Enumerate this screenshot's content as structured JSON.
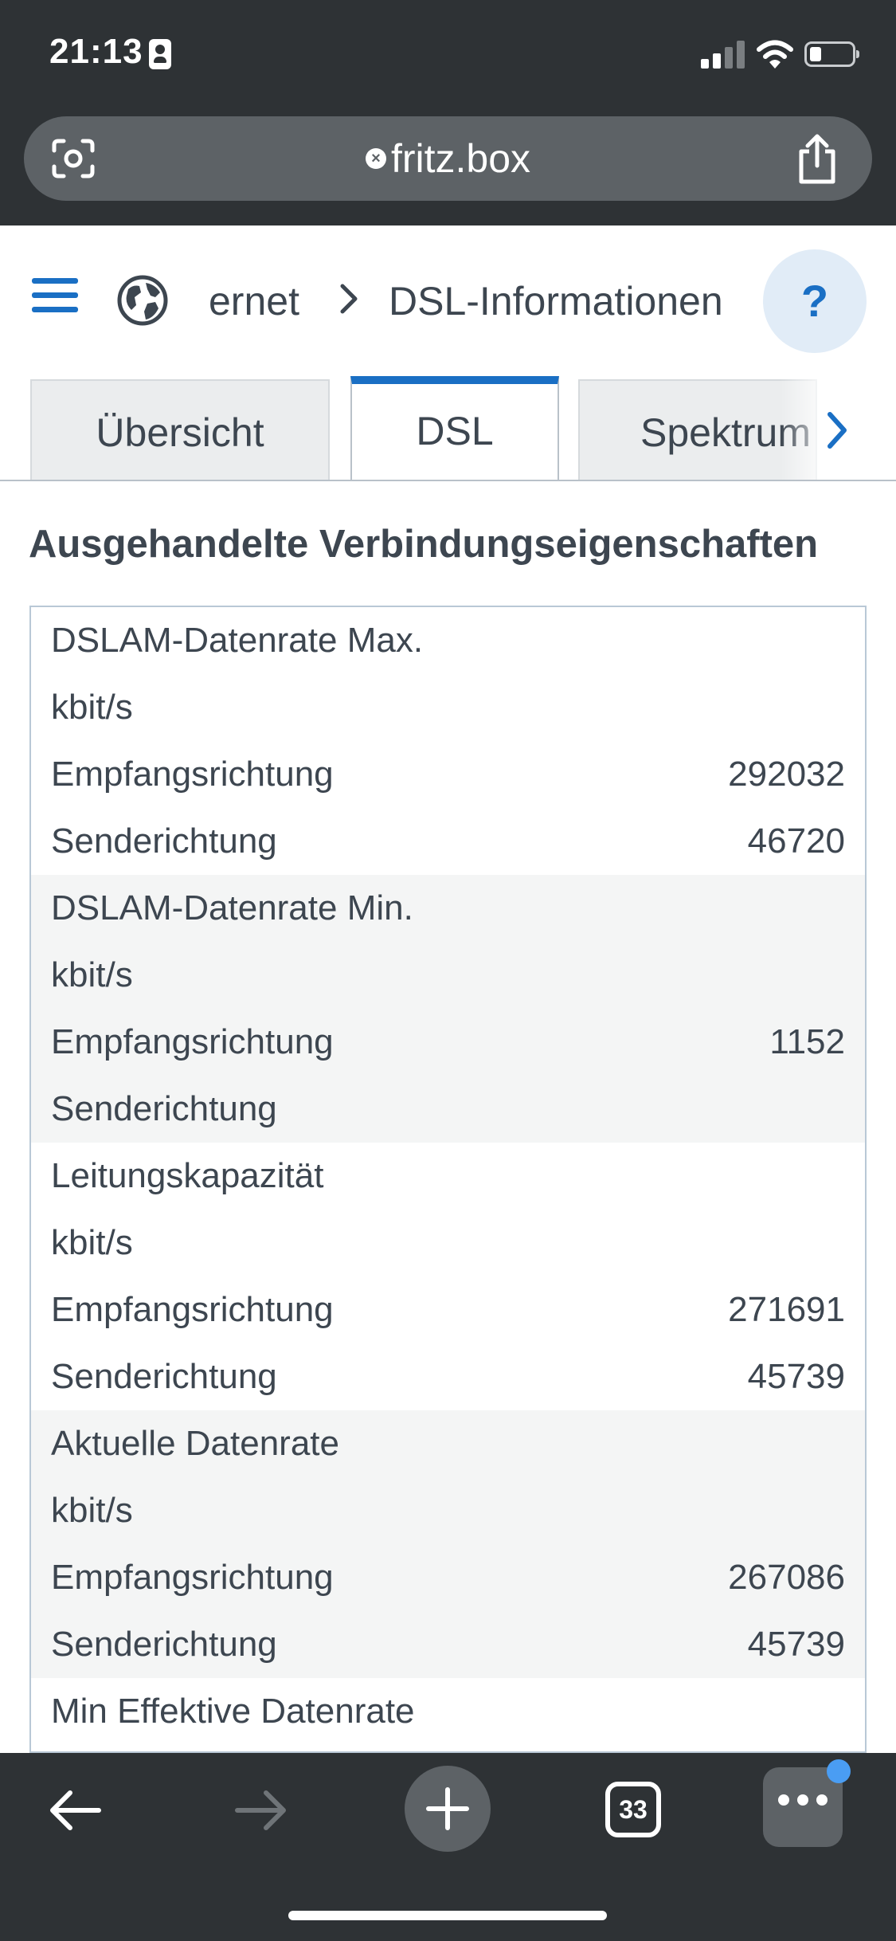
{
  "status_bar": {
    "time": "21:13"
  },
  "url_bar": {
    "url": "fritz.box"
  },
  "header": {
    "breadcrumb_parent": "ernet",
    "breadcrumb_current": "DSL-Informationen",
    "help_label": "?"
  },
  "tabs": [
    {
      "label": "Übersicht",
      "active": false
    },
    {
      "label": "DSL",
      "active": true
    },
    {
      "label": "Spektrum",
      "active": false
    }
  ],
  "section_title": "Ausgehandelte Verbindungseigenschaften",
  "groups": [
    {
      "title": "DSLAM-Datenrate Max.",
      "unit": "kbit/s",
      "rows": [
        {
          "label": "Empfangsrichtung",
          "value": "292032"
        },
        {
          "label": "Senderichtung",
          "value": "46720"
        }
      ]
    },
    {
      "title": "DSLAM-Datenrate Min.",
      "unit": "kbit/s",
      "rows": [
        {
          "label": "Empfangsrichtung",
          "value": "1152"
        },
        {
          "label": "Senderichtung",
          "value": ""
        }
      ]
    },
    {
      "title": "Leitungskapazität",
      "unit": "kbit/s",
      "rows": [
        {
          "label": "Empfangsrichtung",
          "value": "271691"
        },
        {
          "label": "Senderichtung",
          "value": "45739"
        }
      ]
    },
    {
      "title": "Aktuelle Datenrate",
      "unit": "kbit/s",
      "rows": [
        {
          "label": "Empfangsrichtung",
          "value": "267086"
        },
        {
          "label": "Senderichtung",
          "value": "45739"
        }
      ]
    },
    {
      "title": "Min Effektive Datenrate",
      "unit": "",
      "rows": []
    }
  ],
  "toolbar": {
    "tab_count": "33"
  },
  "colors": {
    "accent": "#1a6fc4",
    "chrome": "#2e3235",
    "alt_row": "#f4f5f5",
    "text": "#3d4650"
  }
}
